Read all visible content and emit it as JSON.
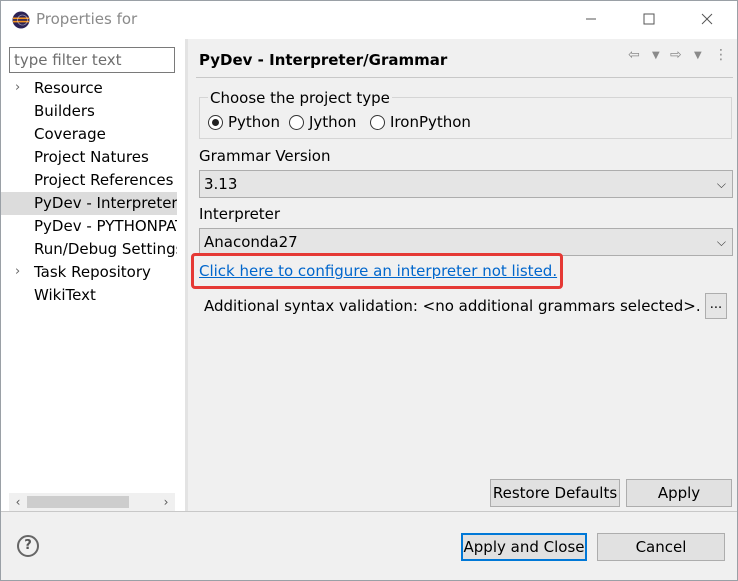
{
  "window": {
    "title": "Properties for",
    "icon": "eclipse-icon",
    "minimize_icon": "minimize-icon",
    "maximize_icon": "maximize-icon",
    "close_icon": "close-icon"
  },
  "sidebar": {
    "filter_placeholder": "type filter text",
    "items": [
      {
        "label": "Resource",
        "expandable": true,
        "selected": false
      },
      {
        "label": "Builders",
        "expandable": false,
        "selected": false
      },
      {
        "label": "Coverage",
        "expandable": false,
        "selected": false
      },
      {
        "label": "Project Natures",
        "expandable": false,
        "selected": false
      },
      {
        "label": "Project References",
        "expandable": false,
        "selected": false
      },
      {
        "label": "PyDev - Interpreter/Grammar",
        "expandable": false,
        "selected": true
      },
      {
        "label": "PyDev - PYTHONPATH",
        "expandable": false,
        "selected": false
      },
      {
        "label": "Run/Debug Settings",
        "expandable": false,
        "selected": false
      },
      {
        "label": "Task Repository",
        "expandable": true,
        "selected": false
      },
      {
        "label": "WikiText",
        "expandable": false,
        "selected": false
      }
    ]
  },
  "page": {
    "title": "PyDev - Interpreter/Grammar",
    "nav": {
      "back_icon": "back-arrow-icon",
      "forward_icon": "forward-arrow-icon",
      "menu_icon": "view-menu-icon"
    },
    "project_type": {
      "legend": "Choose the project type",
      "options": [
        "Python",
        "Jython",
        "IronPython"
      ],
      "selected": "Python"
    },
    "grammar": {
      "label": "Grammar Version",
      "value": "3.13"
    },
    "interpreter": {
      "label": "Interpreter",
      "value": "Anaconda27"
    },
    "configure_link": "Click here to configure an interpreter not listed.",
    "syntax_validation": "Additional syntax validation: <no additional grammars selected>.",
    "syntax_button": "...",
    "restore_defaults": "Restore Defaults",
    "apply": "Apply"
  },
  "footer": {
    "help_icon": "help-icon",
    "apply_and_close": "Apply and Close",
    "cancel": "Cancel"
  },
  "colors": {
    "link": "#0066cc",
    "highlight": "#e53935",
    "default_button_border": "#0078d7",
    "selected_item": "#dcdcdc"
  }
}
